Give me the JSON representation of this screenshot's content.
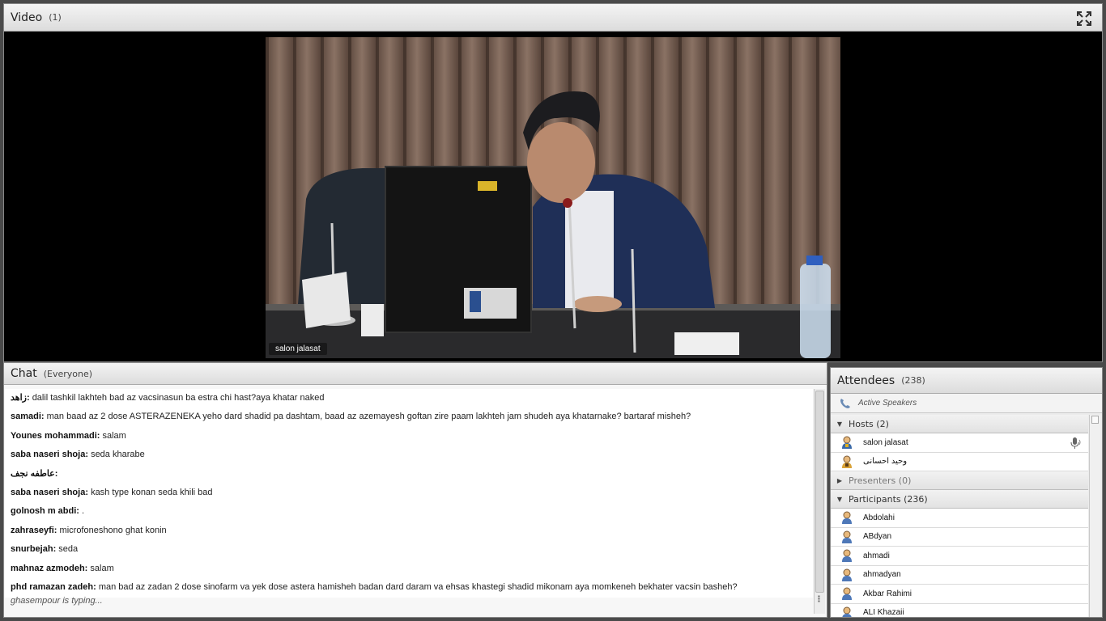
{
  "video": {
    "title": "Video",
    "count": "(1)",
    "name_tag": "salon jalasat"
  },
  "chat": {
    "title": "Chat",
    "scope": "(Everyone)",
    "messages": [
      {
        "sender": "زاهد:",
        "text": "dalil tashkil lakhteh bad az vacsinasun ba estra chi hast?aya khatar naked"
      },
      {
        "sender": "samadi:",
        "text": "man baad az 2 dose ASTERAZENEKA yeho dard shadid pa dashtam, baad az azemayesh goftan zire paam lakhteh jam shudeh aya khatarnake? bartaraf misheh?"
      },
      {
        "sender": "Younes mohammadi:",
        "text": "salam"
      },
      {
        "sender": "saba naseri shoja:",
        "text": "seda kharabe"
      },
      {
        "sender": "عاطفه نجف:",
        "text": ""
      },
      {
        "sender": "saba naseri shoja:",
        "text": "kash type konan seda khili bad"
      },
      {
        "sender": "golnosh m abdi:",
        "text": "."
      },
      {
        "sender": "zahraseyfi:",
        "text": "microfoneshono ghat konin"
      },
      {
        "sender": "snurbejah:",
        "text": "seda"
      },
      {
        "sender": "mahnaz azmodeh:",
        "text": "salam"
      },
      {
        "sender": "phd ramazan zadeh:",
        "text": "man bad az  zadan 2 dose sinofarm va yek dose astera hamisheh badan dard daram va ehsas khastegi shadid mikonam aya momkeneh bekhater vacsin basheh?"
      }
    ],
    "typing": "ghasempour is typing..."
  },
  "attendees": {
    "title": "Attendees",
    "count": "(238)",
    "active_speakers": "Active Speakers",
    "hosts_label": "Hosts (2)",
    "hosts": [
      "salon jalasat",
      "وحید احسانی"
    ],
    "presenters_label": "Presenters (0)",
    "participants_label": "Participants (236)",
    "participants": [
      "Abdolahi",
      "ABdyan",
      "ahmadi",
      "ahmadyan",
      "Akbar Rahimi",
      "ALI Khazaii"
    ]
  }
}
